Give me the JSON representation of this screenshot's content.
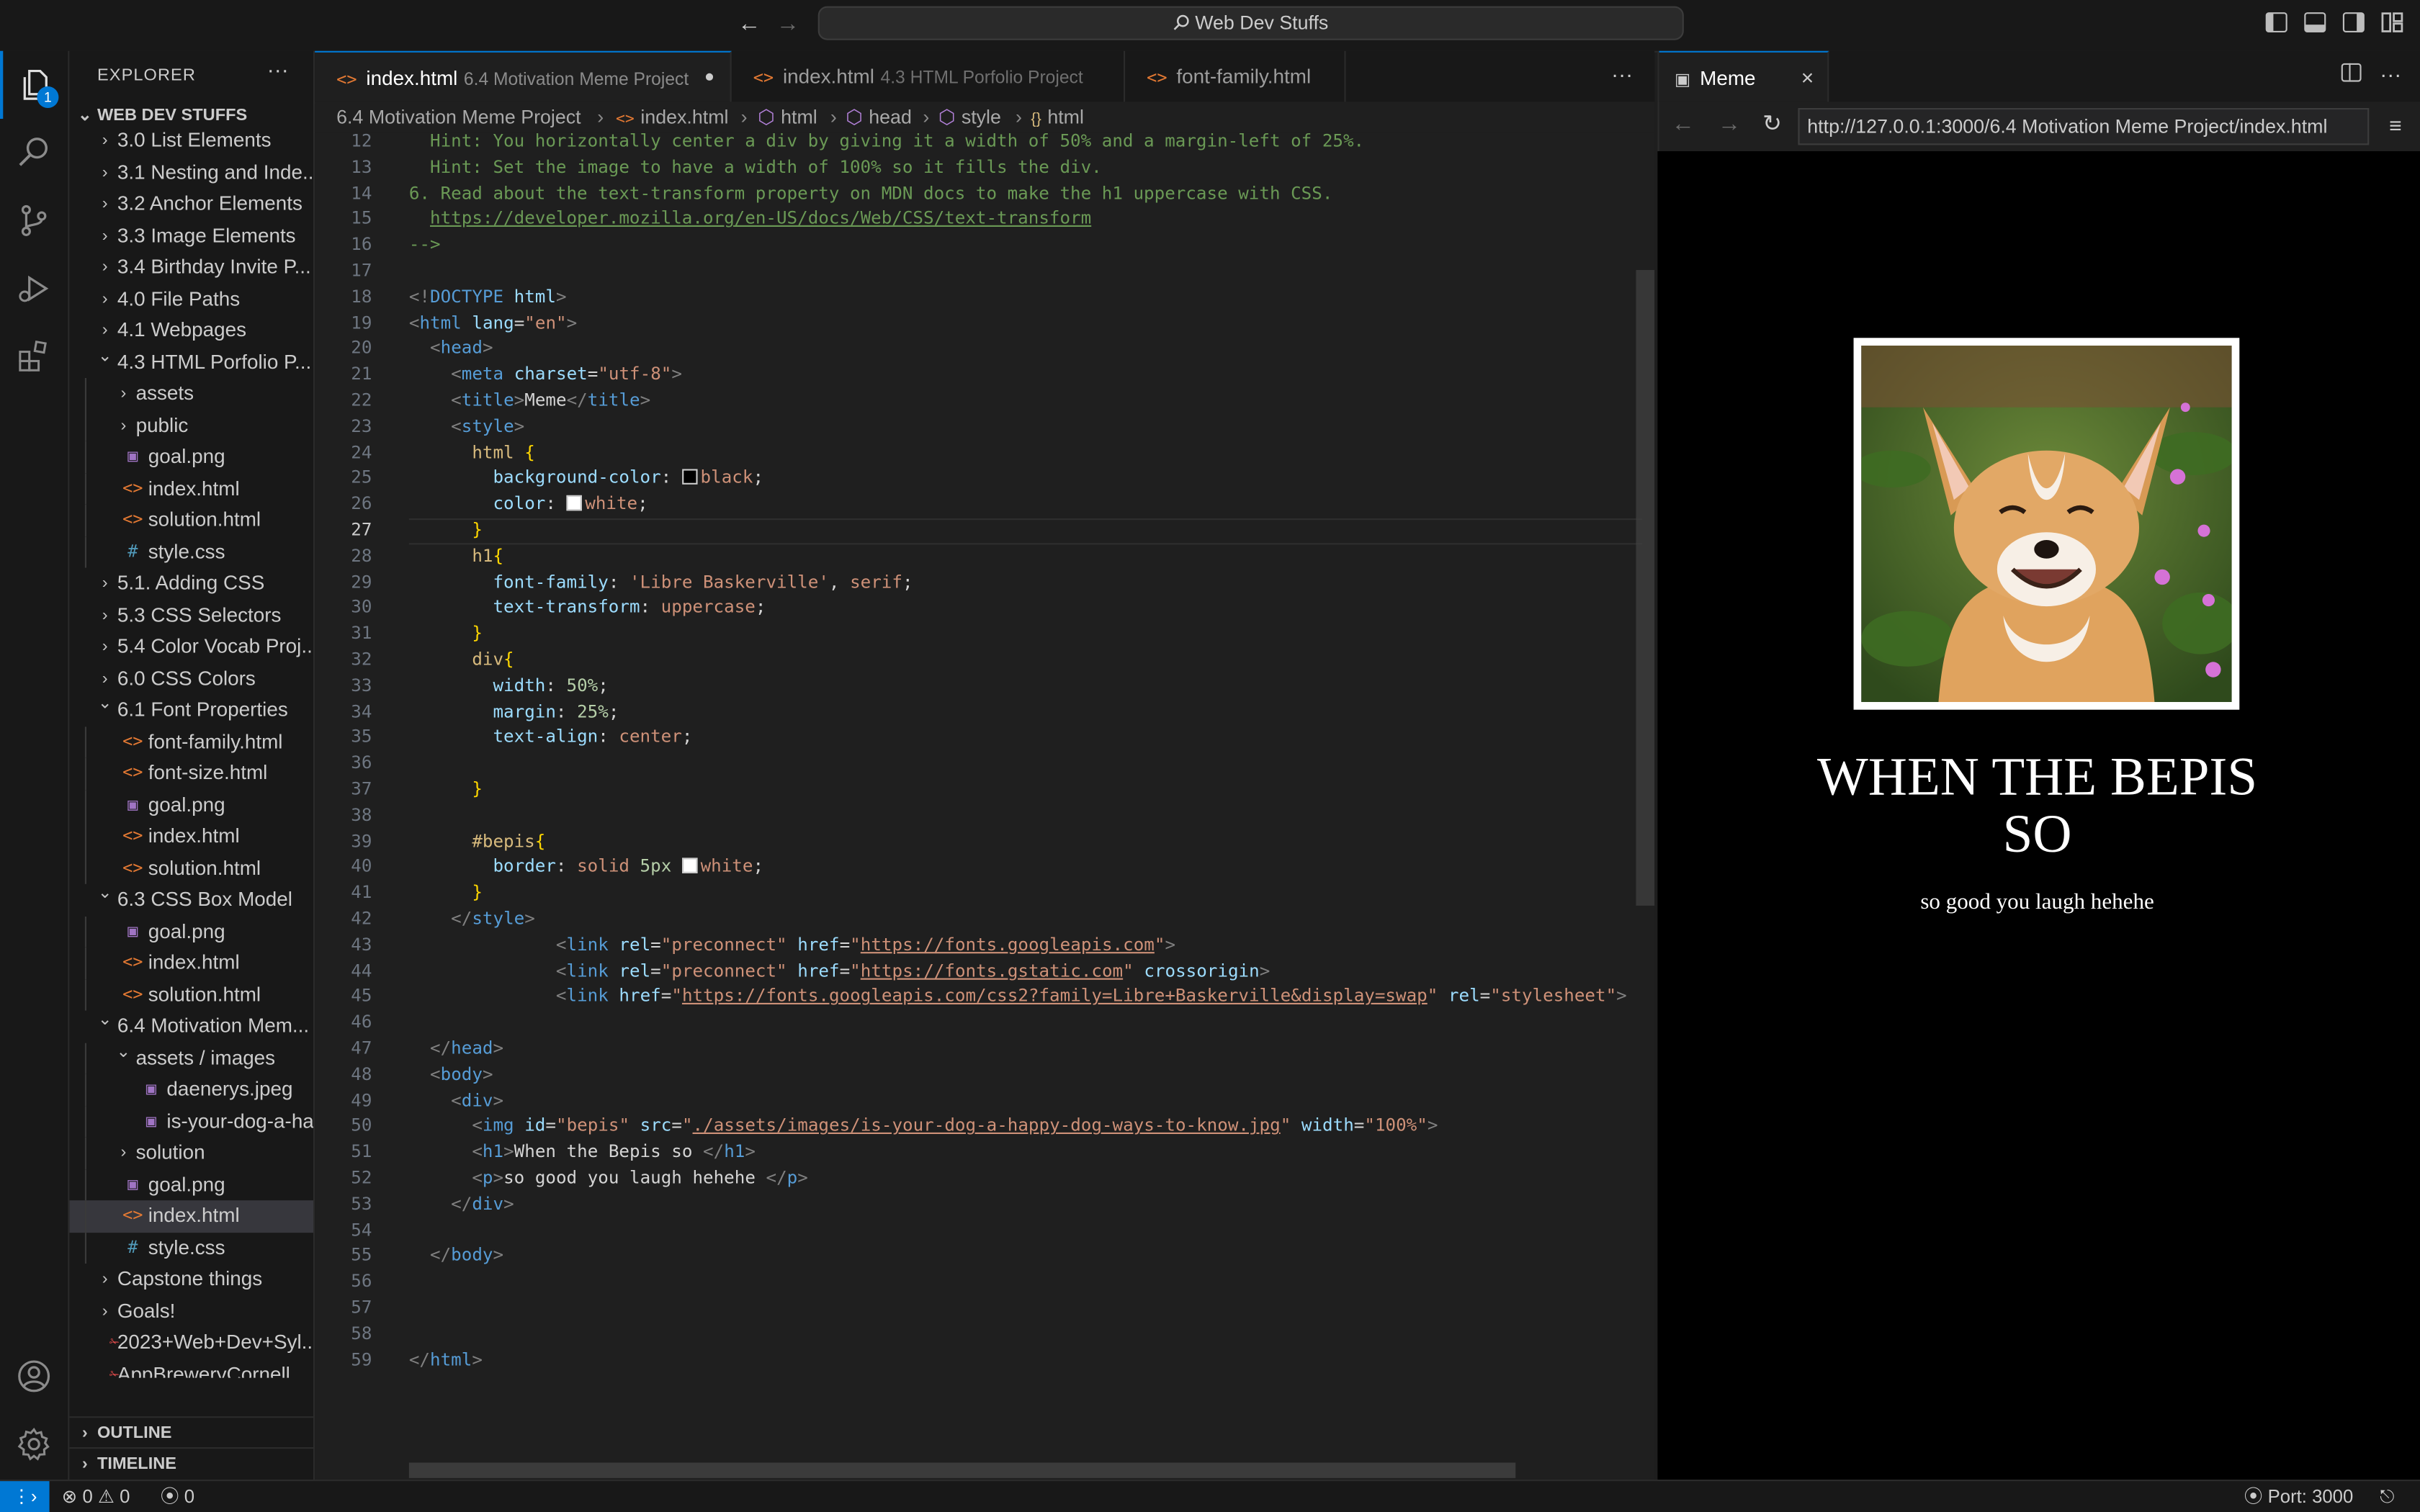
{
  "titlebar": {
    "command_center": "Web Dev Stuffs",
    "back": "←",
    "forward": "→"
  },
  "activity": {
    "badge": "1"
  },
  "explorer": {
    "title": "EXPLORER",
    "more": "···",
    "workspace": "WEB DEV STUFFS",
    "tree": [
      {
        "d": 0,
        "t": "folder",
        "open": false,
        "label": "3.0 List Elements"
      },
      {
        "d": 0,
        "t": "folder",
        "open": false,
        "label": "3.1 Nesting and Inde..."
      },
      {
        "d": 0,
        "t": "folder",
        "open": false,
        "label": "3.2 Anchor Elements"
      },
      {
        "d": 0,
        "t": "folder",
        "open": false,
        "label": "3.3 Image Elements"
      },
      {
        "d": 0,
        "t": "folder",
        "open": false,
        "label": "3.4 Birthday Invite P..."
      },
      {
        "d": 0,
        "t": "folder",
        "open": false,
        "label": "4.0 File Paths"
      },
      {
        "d": 0,
        "t": "folder",
        "open": false,
        "label": "4.1 Webpages"
      },
      {
        "d": 0,
        "t": "folder",
        "open": true,
        "label": "4.3 HTML Porfolio P..."
      },
      {
        "d": 1,
        "t": "folder",
        "open": false,
        "label": "assets"
      },
      {
        "d": 1,
        "t": "folder",
        "open": false,
        "label": "public"
      },
      {
        "d": 1,
        "t": "png",
        "label": "goal.png"
      },
      {
        "d": 1,
        "t": "html",
        "label": "index.html"
      },
      {
        "d": 1,
        "t": "html",
        "label": "solution.html"
      },
      {
        "d": 1,
        "t": "css",
        "label": "style.css"
      },
      {
        "d": 0,
        "t": "folder",
        "open": false,
        "label": "5.1. Adding CSS"
      },
      {
        "d": 0,
        "t": "folder",
        "open": false,
        "label": "5.3 CSS Selectors"
      },
      {
        "d": 0,
        "t": "folder",
        "open": false,
        "label": "5.4 Color Vocab Proj..."
      },
      {
        "d": 0,
        "t": "folder",
        "open": false,
        "label": "6.0 CSS Colors"
      },
      {
        "d": 0,
        "t": "folder",
        "open": true,
        "label": "6.1 Font Properties"
      },
      {
        "d": 1,
        "t": "html",
        "label": "font-family.html"
      },
      {
        "d": 1,
        "t": "html",
        "label": "font-size.html"
      },
      {
        "d": 1,
        "t": "png",
        "label": "goal.png"
      },
      {
        "d": 1,
        "t": "html",
        "label": "index.html"
      },
      {
        "d": 1,
        "t": "html",
        "label": "solution.html"
      },
      {
        "d": 0,
        "t": "folder",
        "open": true,
        "label": "6.3 CSS Box Model"
      },
      {
        "d": 1,
        "t": "png",
        "label": "goal.png"
      },
      {
        "d": 1,
        "t": "html",
        "label": "index.html"
      },
      {
        "d": 1,
        "t": "html",
        "label": "solution.html"
      },
      {
        "d": 0,
        "t": "folder",
        "open": true,
        "label": "6.4 Motivation Mem..."
      },
      {
        "d": 1,
        "t": "folder",
        "open": true,
        "label": "assets / images"
      },
      {
        "d": 2,
        "t": "png",
        "label": "daenerys.jpeg"
      },
      {
        "d": 2,
        "t": "png",
        "label": "is-your-dog-a-ha..."
      },
      {
        "d": 1,
        "t": "folder",
        "open": false,
        "label": "solution"
      },
      {
        "d": 1,
        "t": "png",
        "label": "goal.png"
      },
      {
        "d": 1,
        "t": "html",
        "label": "index.html",
        "selected": true
      },
      {
        "d": 1,
        "t": "css",
        "label": "style.css"
      },
      {
        "d": 0,
        "t": "folder",
        "open": false,
        "label": "Capstone things"
      },
      {
        "d": 0,
        "t": "folder",
        "open": false,
        "label": "Goals!"
      },
      {
        "d": 0,
        "t": "pdf",
        "label": "2023+Web+Dev+Syl..."
      },
      {
        "d": 0,
        "t": "pdf",
        "label": "AppBreweryCornell..."
      }
    ],
    "outline": "OUTLINE",
    "timeline": "TIMELINE"
  },
  "tabs": [
    {
      "label": "index.html",
      "desc": "6.4 Motivation Meme Project",
      "active": true,
      "dirty": true
    },
    {
      "label": "index.html",
      "desc": "4.3 HTML Porfolio Project",
      "active": false
    },
    {
      "label": "font-family.html",
      "desc": "",
      "active": false
    }
  ],
  "tabs_more": "···",
  "breadcrumb": [
    "6.4 Motivation Meme Project",
    "index.html",
    "html",
    "head",
    "style",
    "html"
  ],
  "current_line": 27,
  "code": [
    {
      "n": 12,
      "tk": [
        [
          "cm",
          "  Hint: You horizontally center a div by giving it a width of 50% and a margin-left of 25%."
        ]
      ]
    },
    {
      "n": 13,
      "tk": [
        [
          "cm",
          "  Hint: Set the image to have a width of 100% so it fills the div."
        ]
      ]
    },
    {
      "n": 14,
      "tk": [
        [
          "cm",
          "6. Read about the text-transform property on MDN docs to make the h1 uppercase with CSS."
        ]
      ]
    },
    {
      "n": 15,
      "tk": [
        [
          "cm",
          "  "
        ],
        [
          "cml",
          "https://developer.mozilla.org/en-US/docs/Web/CSS/text-transform"
        ]
      ]
    },
    {
      "n": 16,
      "tk": [
        [
          "cm",
          "-->"
        ]
      ]
    },
    {
      "n": 17,
      "tk": []
    },
    {
      "n": 18,
      "tk": [
        [
          "tag",
          "<!"
        ],
        [
          "tn",
          "DOCTYPE"
        ],
        [
          "txt",
          " "
        ],
        [
          "at",
          "html"
        ],
        [
          "tag",
          ">"
        ]
      ]
    },
    {
      "n": 19,
      "tk": [
        [
          "tag",
          "<"
        ],
        [
          "tn",
          "html"
        ],
        [
          "txt",
          " "
        ],
        [
          "at",
          "lang"
        ],
        [
          "txt",
          "="
        ],
        [
          "str",
          "\"en\""
        ],
        [
          "tag",
          ">"
        ]
      ]
    },
    {
      "n": 20,
      "tk": [
        [
          "txt",
          "  "
        ],
        [
          "tag",
          "<"
        ],
        [
          "tn",
          "head"
        ],
        [
          "tag",
          ">"
        ]
      ]
    },
    {
      "n": 21,
      "tk": [
        [
          "txt",
          "    "
        ],
        [
          "tag",
          "<"
        ],
        [
          "tn",
          "meta"
        ],
        [
          "txt",
          " "
        ],
        [
          "at",
          "charset"
        ],
        [
          "txt",
          "="
        ],
        [
          "str",
          "\"utf-8\""
        ],
        [
          "tag",
          ">"
        ]
      ]
    },
    {
      "n": 22,
      "tk": [
        [
          "txt",
          "    "
        ],
        [
          "tag",
          "<"
        ],
        [
          "tn",
          "title"
        ],
        [
          "tag",
          ">"
        ],
        [
          "txt",
          "Meme"
        ],
        [
          "tag",
          "</"
        ],
        [
          "tn",
          "title"
        ],
        [
          "tag",
          ">"
        ]
      ]
    },
    {
      "n": 23,
      "tk": [
        [
          "txt",
          "    "
        ],
        [
          "tag",
          "<"
        ],
        [
          "tn",
          "style"
        ],
        [
          "tag",
          ">"
        ]
      ]
    },
    {
      "n": 24,
      "tk": [
        [
          "txt",
          "      "
        ],
        [
          "sel",
          "html"
        ],
        [
          "txt",
          " "
        ],
        [
          "br",
          "{"
        ]
      ]
    },
    {
      "n": 25,
      "tk": [
        [
          "txt",
          "        "
        ],
        [
          "prop",
          "background-color"
        ],
        [
          "txt",
          ": "
        ],
        [
          "swb",
          ""
        ],
        [
          "val",
          "black"
        ],
        [
          "txt",
          ";"
        ]
      ]
    },
    {
      "n": 26,
      "tk": [
        [
          "txt",
          "        "
        ],
        [
          "prop",
          "color"
        ],
        [
          "txt",
          ": "
        ],
        [
          "sww",
          ""
        ],
        [
          "val",
          "white"
        ],
        [
          "txt",
          ";"
        ]
      ]
    },
    {
      "n": 27,
      "tk": [
        [
          "txt",
          "      "
        ],
        [
          "br",
          "}"
        ]
      ]
    },
    {
      "n": 28,
      "tk": [
        [
          "txt",
          "      "
        ],
        [
          "sel",
          "h1"
        ],
        [
          "br",
          "{"
        ]
      ]
    },
    {
      "n": 29,
      "tk": [
        [
          "txt",
          "        "
        ],
        [
          "prop",
          "font-family"
        ],
        [
          "txt",
          ": "
        ],
        [
          "val",
          "'Libre Baskerville'"
        ],
        [
          "txt",
          ", "
        ],
        [
          "val",
          "serif"
        ],
        [
          "txt",
          ";"
        ]
      ]
    },
    {
      "n": 30,
      "tk": [
        [
          "txt",
          "        "
        ],
        [
          "prop",
          "text-transform"
        ],
        [
          "txt",
          ": "
        ],
        [
          "val",
          "uppercase"
        ],
        [
          "txt",
          ";"
        ]
      ]
    },
    {
      "n": 31,
      "tk": [
        [
          "txt",
          "      "
        ],
        [
          "br",
          "}"
        ]
      ]
    },
    {
      "n": 32,
      "tk": [
        [
          "txt",
          "      "
        ],
        [
          "sel",
          "div"
        ],
        [
          "br",
          "{"
        ]
      ]
    },
    {
      "n": 33,
      "tk": [
        [
          "txt",
          "        "
        ],
        [
          "prop",
          "width"
        ],
        [
          "txt",
          ": "
        ],
        [
          "num",
          "50%"
        ],
        [
          "txt",
          ";"
        ]
      ]
    },
    {
      "n": 34,
      "tk": [
        [
          "txt",
          "        "
        ],
        [
          "prop",
          "margin"
        ],
        [
          "txt",
          ": "
        ],
        [
          "num",
          "25%"
        ],
        [
          "txt",
          ";"
        ]
      ]
    },
    {
      "n": 35,
      "tk": [
        [
          "txt",
          "        "
        ],
        [
          "prop",
          "text-align"
        ],
        [
          "txt",
          ": "
        ],
        [
          "val",
          "center"
        ],
        [
          "txt",
          ";"
        ]
      ]
    },
    {
      "n": 36,
      "tk": []
    },
    {
      "n": 37,
      "tk": [
        [
          "txt",
          "      "
        ],
        [
          "br",
          "}"
        ]
      ]
    },
    {
      "n": 38,
      "tk": []
    },
    {
      "n": 39,
      "tk": [
        [
          "txt",
          "      "
        ],
        [
          "sel",
          "#bepis"
        ],
        [
          "br",
          "{"
        ]
      ]
    },
    {
      "n": 40,
      "tk": [
        [
          "txt",
          "        "
        ],
        [
          "prop",
          "border"
        ],
        [
          "txt",
          ": "
        ],
        [
          "val",
          "solid "
        ],
        [
          "num",
          "5px"
        ],
        [
          "txt",
          " "
        ],
        [
          "sww",
          ""
        ],
        [
          "val",
          "white"
        ],
        [
          "txt",
          ";"
        ]
      ]
    },
    {
      "n": 41,
      "tk": [
        [
          "txt",
          "      "
        ],
        [
          "br",
          "}"
        ]
      ]
    },
    {
      "n": 42,
      "tk": [
        [
          "txt",
          "    "
        ],
        [
          "tag",
          "</"
        ],
        [
          "tn",
          "style"
        ],
        [
          "tag",
          ">"
        ]
      ]
    },
    {
      "n": 43,
      "tk": [
        [
          "txt",
          "              "
        ],
        [
          "tag",
          "<"
        ],
        [
          "tn",
          "link"
        ],
        [
          "txt",
          " "
        ],
        [
          "at",
          "rel"
        ],
        [
          "txt",
          "="
        ],
        [
          "str",
          "\"preconnect\""
        ],
        [
          "txt",
          " "
        ],
        [
          "at",
          "href"
        ],
        [
          "txt",
          "="
        ],
        [
          "str",
          "\""
        ],
        [
          "strl",
          "https://fonts.googleapis.com"
        ],
        [
          "str",
          "\""
        ],
        [
          "tag",
          ">"
        ]
      ]
    },
    {
      "n": 44,
      "tk": [
        [
          "txt",
          "              "
        ],
        [
          "tag",
          "<"
        ],
        [
          "tn",
          "link"
        ],
        [
          "txt",
          " "
        ],
        [
          "at",
          "rel"
        ],
        [
          "txt",
          "="
        ],
        [
          "str",
          "\"preconnect\""
        ],
        [
          "txt",
          " "
        ],
        [
          "at",
          "href"
        ],
        [
          "txt",
          "="
        ],
        [
          "str",
          "\""
        ],
        [
          "strl",
          "https://fonts.gstatic.com"
        ],
        [
          "str",
          "\""
        ],
        [
          "txt",
          " "
        ],
        [
          "at",
          "crossorigin"
        ],
        [
          "tag",
          ">"
        ]
      ]
    },
    {
      "n": 45,
      "tk": [
        [
          "txt",
          "              "
        ],
        [
          "tag",
          "<"
        ],
        [
          "tn",
          "link"
        ],
        [
          "txt",
          " "
        ],
        [
          "at",
          "href"
        ],
        [
          "txt",
          "="
        ],
        [
          "str",
          "\""
        ],
        [
          "strl",
          "https://fonts.googleapis.com/css2?family=Libre+Baskerville&display=swap"
        ],
        [
          "str",
          "\""
        ],
        [
          "txt",
          " "
        ],
        [
          "at",
          "rel"
        ],
        [
          "txt",
          "="
        ],
        [
          "str",
          "\"stylesheet\""
        ],
        [
          "tag",
          ">"
        ]
      ]
    },
    {
      "n": 46,
      "tk": []
    },
    {
      "n": 47,
      "tk": [
        [
          "txt",
          "  "
        ],
        [
          "tag",
          "</"
        ],
        [
          "tn",
          "head"
        ],
        [
          "tag",
          ">"
        ]
      ]
    },
    {
      "n": 48,
      "tk": [
        [
          "txt",
          "  "
        ],
        [
          "tag",
          "<"
        ],
        [
          "tn",
          "body"
        ],
        [
          "tag",
          ">"
        ]
      ]
    },
    {
      "n": 49,
      "tk": [
        [
          "txt",
          "    "
        ],
        [
          "tag",
          "<"
        ],
        [
          "tn",
          "div"
        ],
        [
          "tag",
          ">"
        ]
      ]
    },
    {
      "n": 50,
      "tk": [
        [
          "txt",
          "      "
        ],
        [
          "tag",
          "<"
        ],
        [
          "tn",
          "img"
        ],
        [
          "txt",
          " "
        ],
        [
          "at",
          "id"
        ],
        [
          "txt",
          "="
        ],
        [
          "str",
          "\"bepis\""
        ],
        [
          "txt",
          " "
        ],
        [
          "at",
          "src"
        ],
        [
          "txt",
          "="
        ],
        [
          "str",
          "\""
        ],
        [
          "strl",
          "./assets/images/is-your-dog-a-happy-dog-ways-to-know.jpg"
        ],
        [
          "str",
          "\""
        ],
        [
          "txt",
          " "
        ],
        [
          "at",
          "width"
        ],
        [
          "txt",
          "="
        ],
        [
          "str",
          "\"100%\""
        ],
        [
          "tag",
          ">"
        ]
      ]
    },
    {
      "n": 51,
      "tk": [
        [
          "txt",
          "      "
        ],
        [
          "tag",
          "<"
        ],
        [
          "tn",
          "h1"
        ],
        [
          "tag",
          ">"
        ],
        [
          "txt",
          "When the Bepis so "
        ],
        [
          "tag",
          "</"
        ],
        [
          "tn",
          "h1"
        ],
        [
          "tag",
          ">"
        ]
      ]
    },
    {
      "n": 52,
      "tk": [
        [
          "txt",
          "      "
        ],
        [
          "tag",
          "<"
        ],
        [
          "tn",
          "p"
        ],
        [
          "tag",
          ">"
        ],
        [
          "txt",
          "so good you laugh hehehe "
        ],
        [
          "tag",
          "</"
        ],
        [
          "tn",
          "p"
        ],
        [
          "tag",
          ">"
        ]
      ]
    },
    {
      "n": 53,
      "tk": [
        [
          "txt",
          "    "
        ],
        [
          "tag",
          "</"
        ],
        [
          "tn",
          "div"
        ],
        [
          "tag",
          ">"
        ]
      ]
    },
    {
      "n": 54,
      "tk": []
    },
    {
      "n": 55,
      "tk": [
        [
          "txt",
          "  "
        ],
        [
          "tag",
          "</"
        ],
        [
          "tn",
          "body"
        ],
        [
          "tag",
          ">"
        ]
      ]
    },
    {
      "n": 56,
      "tk": []
    },
    {
      "n": 57,
      "tk": []
    },
    {
      "n": 58,
      "tk": []
    },
    {
      "n": 59,
      "tk": [
        [
          "tag",
          "</"
        ],
        [
          "tn",
          "html"
        ],
        [
          "tag",
          ">"
        ]
      ]
    }
  ],
  "preview": {
    "tab": "Meme",
    "url": "http://127.0.0.1:3000/6.4 Motivation Meme Project/index.html",
    "heading": "When the Bepis so",
    "paragraph": "so good you laugh hehehe"
  },
  "status": {
    "errors": "0",
    "warnings": "0",
    "ports_info": "0",
    "port": "Port: 3000"
  }
}
